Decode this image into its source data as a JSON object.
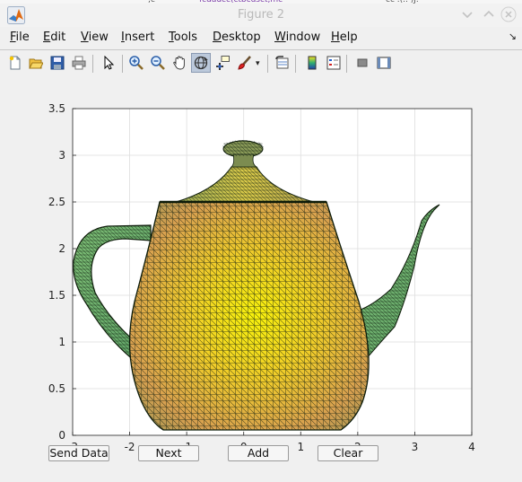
{
  "window": {
    "title": "Figure 2",
    "controls": [
      "chevron-down-icon",
      "chevron-up-icon",
      "close-icon"
    ]
  },
  "menubar": {
    "items": [
      {
        "key": "F",
        "rest": "ile"
      },
      {
        "key": "E",
        "rest": "dit"
      },
      {
        "key": "V",
        "rest": "iew"
      },
      {
        "key": "I",
        "rest": "nsert"
      },
      {
        "key": "T",
        "rest": "ools"
      },
      {
        "key": "D",
        "rest": "esktop"
      },
      {
        "key": "W",
        "rest": "indow"
      },
      {
        "key": "H",
        "rest": "elp"
      }
    ],
    "dock_glyph": "↘"
  },
  "toolbar": {
    "tools": [
      "new-figure-icon",
      "open-file-icon",
      "save-icon",
      "print-icon",
      "edit-plot-icon",
      "zoom-in-icon",
      "zoom-out-icon",
      "pan-icon",
      "rotate-3d-icon",
      "data-cursor-icon",
      "brush-icon",
      "link-plot-icon",
      "colorbar-icon",
      "legend-icon",
      "hide-plot-tools-icon",
      "show-plot-tools-icon"
    ],
    "active_tool": "rotate-3d-icon"
  },
  "chart_data": {
    "type": "surface",
    "subject": "teapot",
    "colormap": "summer",
    "grid": true,
    "xlim": [
      -3,
      4
    ],
    "ylim": [
      0,
      3.5
    ],
    "x_ticks": [
      "-3",
      "-2",
      "-1",
      "0",
      "1",
      "2",
      "3",
      "4"
    ],
    "y_ticks": [
      "0",
      "0.5",
      "1",
      "1.5",
      "2",
      "2.5",
      "3",
      "3.5"
    ]
  },
  "controls": {
    "send_data": "Send Data",
    "next": "Next",
    "add": "Add",
    "clear": "Clear"
  }
}
